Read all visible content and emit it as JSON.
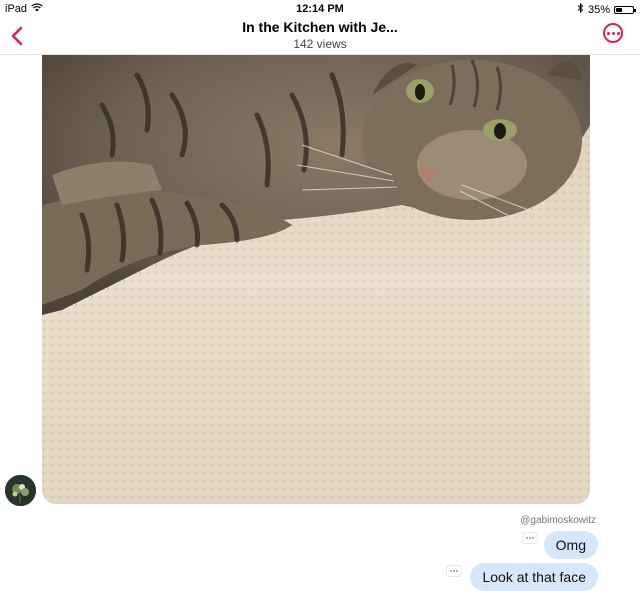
{
  "status_bar": {
    "device": "iPad",
    "time": "12:14 PM",
    "battery": "35%",
    "battery_level": 0.35,
    "icons": [
      "wifi-icon",
      "bluetooth-icon",
      "battery-icon"
    ]
  },
  "header": {
    "title": "In the Kitchen with Je...",
    "subtitle": "142 views",
    "back_icon": "chevron-left-icon",
    "more_icon": "more-options-icon",
    "accent_color": "#e0204a"
  },
  "message": {
    "photo_icon": "cat-photo",
    "username": "@gabimoskowitz",
    "bubbles": [
      {
        "text": "Omg"
      },
      {
        "text": "Look at that face"
      }
    ],
    "bubble_color": "#d6e7fb"
  }
}
